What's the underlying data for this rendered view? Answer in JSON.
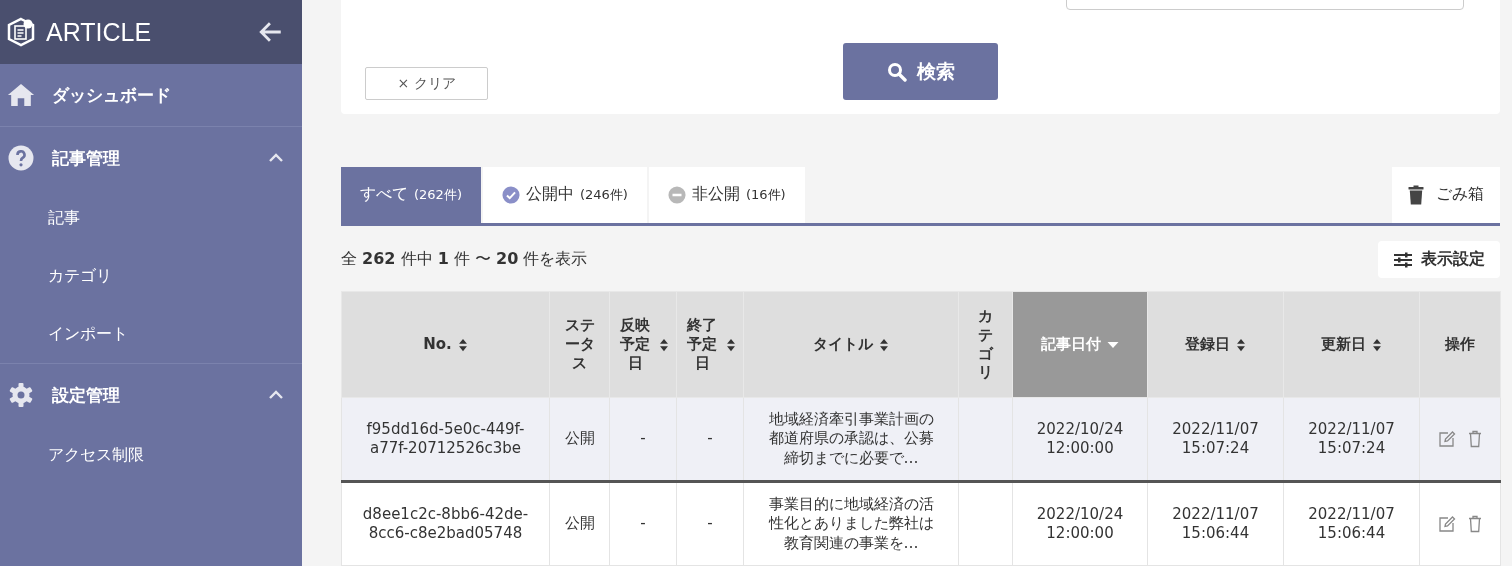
{
  "sidebar": {
    "title": "ARTICLE",
    "items": [
      {
        "label": "ダッシュボード",
        "kind": "home"
      },
      {
        "label": "記事管理",
        "kind": "question",
        "expanded": true,
        "children": [
          {
            "label": "記事"
          },
          {
            "label": "カテゴリ"
          },
          {
            "label": "インポート"
          }
        ]
      },
      {
        "label": "設定管理",
        "kind": "gear",
        "expanded": true,
        "children": [
          {
            "label": "アクセス制限"
          }
        ]
      }
    ]
  },
  "search": {
    "clear_icon": "×",
    "clear_label": "クリア",
    "search_label": "検索"
  },
  "tabs": [
    {
      "label": "すべて",
      "count": "(262件)",
      "kind": "all",
      "selected": true
    },
    {
      "label": "公開中",
      "count": "(246件)",
      "kind": "public",
      "selected": false
    },
    {
      "label": "非公開",
      "count": "(16件)",
      "kind": "private",
      "selected": false
    }
  ],
  "trash_button": "ごみ箱",
  "result_count": "全 **262** 件中 **1** 件 〜 **20** 件を表示",
  "display_settings_button": "表示設定",
  "table": {
    "columns": [
      {
        "label": "No.",
        "sortable": true,
        "selected": false
      },
      {
        "label": "ステータス",
        "sortable": false,
        "selected": false
      },
      {
        "label": "反映予定日",
        "sortable": true,
        "selected": false
      },
      {
        "label": "終了予定日",
        "sortable": true,
        "selected": false
      },
      {
        "label": "タイトル",
        "sortable": true,
        "selected": false
      },
      {
        "label": "カテゴリ",
        "sortable": false,
        "selected": false
      },
      {
        "label": "記事日付",
        "sortable": true,
        "selected": true
      },
      {
        "label": "登録日",
        "sortable": true,
        "selected": false
      },
      {
        "label": "更新日",
        "sortable": true,
        "selected": false
      },
      {
        "label": "操作",
        "sortable": false,
        "selected": false
      }
    ],
    "rows": [
      {
        "selected": true,
        "no": "f95dd16d-5e0c-449f-a77f-20712526c3be",
        "status": "公開",
        "publish_date": "-",
        "end_date": "-",
        "title": "地域経済牽引事業計画の都道府県の承認は、公募締切までに必要で…",
        "article_date": "2022/10/24 12:00:00",
        "created": "2022/11/07 15:07:24",
        "updated": "2022/11/07 15:07:24"
      },
      {
        "selected": false,
        "no": "d8ee1c2c-8bb6-42de-8cc6-c8e2bad05748",
        "status": "公開",
        "publish_date": "-",
        "end_date": "-",
        "title": "事業目的に地域経済の活性化とありました弊社は教育関連の事業を…",
        "article_date": "2022/10/24 12:00:00",
        "created": "2022/11/07 15:06:44",
        "updated": "2022/11/07 15:06:44"
      }
    ]
  }
}
